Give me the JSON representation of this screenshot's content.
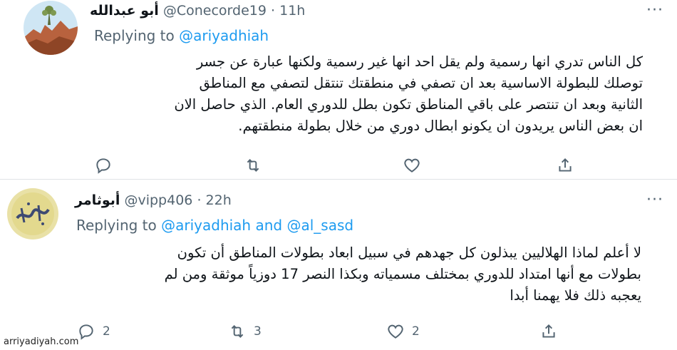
{
  "tweets": [
    {
      "name": "أبو عبدالله",
      "handle": "@Conecorde19",
      "dot": "·",
      "time": "11h",
      "replying_prefix": "Replying to",
      "replying_to": "@ariyadhiah",
      "replying_joiner": "",
      "replying_to_2": "",
      "lines": [
        "كل الناس تدري انها رسمية ولم يقل احد انها غير رسمية ولكنها عبارة عن جسر",
        "توصلك للبطولة الاساسية بعد ان تصفي في منطقتك تنتقل لتصفي مع المناطق",
        "الثانية وبعد ان تنتصر على باقي المناطق تكون بطل للدوري العام. الذي حاصل الان",
        "ان بعض الناس يريدون ان يكونو ابطال دوري من خلال بطولة منطقتهم."
      ],
      "reply_count": "",
      "retweet_count": "",
      "like_count": ""
    },
    {
      "name": "أبوثامر",
      "handle": "@vipp406",
      "dot": "·",
      "time": "22h",
      "replying_prefix": "Replying to",
      "replying_to": "@ariyadhiah",
      "replying_joiner": "and",
      "replying_to_2": "@al_sasd",
      "lines": [
        "لا أعلم لماذا الهلاليين يبذلون كل جهدهم في سبيل ابعاد بطولات المناطق أن تكون",
        "بطولات مع أنها امتداد للدوري بمختلف مسمياته وبكذا النصر 17 دوزياً موثقة ومن لم",
        "يعجبه ذلك فلا يهمنا أبدا"
      ],
      "reply_count": "2",
      "retweet_count": "3",
      "like_count": "2"
    }
  ],
  "more_icon": "more-horizontal-icon",
  "watermark": "arriyadiyah.com",
  "colors": {
    "link": "#1d9bf0",
    "muted": "#536471",
    "text": "#0f1419"
  }
}
